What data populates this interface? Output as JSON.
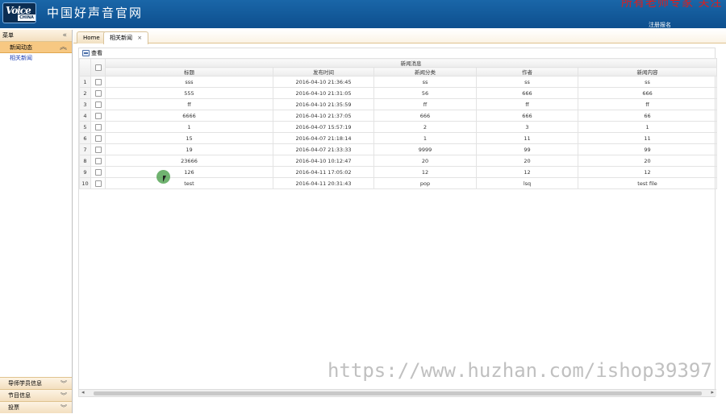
{
  "header": {
    "logo_line1": "Voice",
    "logo_line2": "CHINA",
    "site_title": "中国好声音官网",
    "red_text": "所有老师专家 关注",
    "register_link": "注册报名"
  },
  "left_menu": {
    "title": "菜单",
    "section": "新闻动态",
    "items": [
      "相关新闻"
    ],
    "accordion": [
      "导师学员信息",
      "节目信息",
      "投票"
    ]
  },
  "tabs": [
    {
      "label": "Home",
      "active": false
    },
    {
      "label": "相关新闻",
      "active": true,
      "close": "×"
    }
  ],
  "toolbar": {
    "view_label": "查看"
  },
  "table": {
    "group_header": "新闻消息",
    "columns": [
      "标题",
      "发布时间",
      "新闻分类",
      "作者",
      "新闻内容"
    ],
    "rows": [
      {
        "n": "1",
        "title": "sss",
        "time": "2016-04-10 21:36:45",
        "category": "ss",
        "author": "ss",
        "content": "ss"
      },
      {
        "n": "2",
        "title": "555",
        "time": "2016-04-10 21:31:05",
        "category": "56",
        "author": "666",
        "content": "666"
      },
      {
        "n": "3",
        "title": "ff",
        "time": "2016-04-10 21:35:59",
        "category": "ff",
        "author": "ff",
        "content": "ff"
      },
      {
        "n": "4",
        "title": "6666",
        "time": "2016-04-10 21:37:05",
        "category": "666",
        "author": "666",
        "content": "66"
      },
      {
        "n": "5",
        "title": "1",
        "time": "2016-04-07 15:57:19",
        "category": "2",
        "author": "3",
        "content": "1"
      },
      {
        "n": "6",
        "title": "15",
        "time": "2016-04-07 21:18:14",
        "category": "1",
        "author": "11",
        "content": "11"
      },
      {
        "n": "7",
        "title": "19",
        "time": "2016-04-07 21:33:33",
        "category": "9999",
        "author": "99",
        "content": "99"
      },
      {
        "n": "8",
        "title": "23666",
        "time": "2016-04-10 10:12:47",
        "category": "20",
        "author": "20",
        "content": "20"
      },
      {
        "n": "9",
        "title": "126",
        "time": "2016-04-11 17:05:02",
        "category": "12",
        "author": "12",
        "content": "12"
      },
      {
        "n": "10",
        "title": "test",
        "time": "2016-04-11 20:31:43",
        "category": "pop",
        "author": "lsq",
        "content": "test file"
      }
    ]
  },
  "scrollbar": {
    "left_arrow": "◂",
    "right_arrow": "▸"
  },
  "watermark": "https://www.huzhan.com/ishop39397",
  "colors": {
    "header_bg": "#1565a8",
    "accent": "#f7c882",
    "link": "#1b3cb3",
    "red": "#d82020"
  }
}
